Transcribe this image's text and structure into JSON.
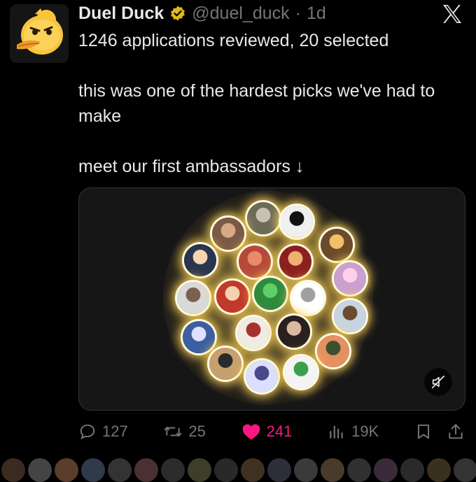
{
  "post": {
    "display_name": "Duel Duck",
    "handle": "@duel_duck",
    "separator": "·",
    "time": "1d",
    "text_lines": [
      "1246 applications reviewed, 20 selected",
      "this was one of the hardest picks we've had to make",
      "meet our first ambassadors ↓"
    ]
  },
  "icons": {
    "avatar": "duck-avatar-icon",
    "verified": "verified-badge-icon",
    "platform": "x-logo-icon",
    "mute": "video-muted-icon",
    "reply": "reply-icon",
    "repost": "repost-icon",
    "like": "heart-icon",
    "views": "views-icon",
    "bookmark": "bookmark-icon",
    "share": "share-icon"
  },
  "media": {
    "type": "video",
    "description_count": 20
  },
  "actions": {
    "replies": "127",
    "reposts": "25",
    "likes": "241",
    "views": "19K"
  },
  "colors": {
    "background": "#000000",
    "text": "#e7e9ea",
    "muted": "#71767b",
    "like": "#f91880",
    "verified": "#e2b719"
  }
}
